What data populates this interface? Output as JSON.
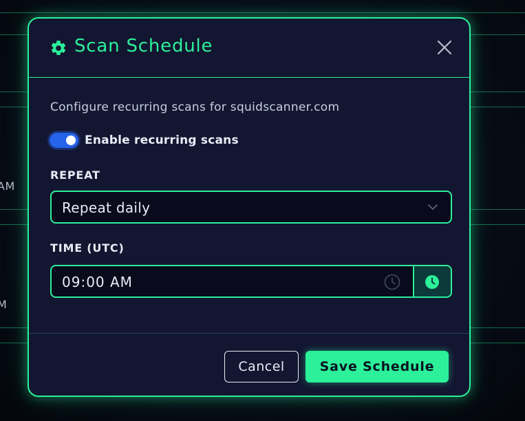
{
  "background": {
    "row_times": [
      "AM",
      "M"
    ]
  },
  "modal": {
    "title": "Scan Schedule",
    "title_icon": "gear-icon",
    "close_icon": "close-icon",
    "description": "Configure recurring scans for squidscanner.com",
    "toggle": {
      "label": "Enable recurring scans",
      "enabled": true
    },
    "repeat": {
      "label": "REPEAT",
      "selected": "Repeat daily"
    },
    "time": {
      "label": "TIME (UTC)",
      "value": "09:00 AM",
      "input_icon": "clock-icon",
      "button_icon": "clock-icon"
    },
    "buttons": {
      "cancel": "Cancel",
      "save": "Save Schedule"
    }
  },
  "colors": {
    "accent": "#2cf09a",
    "modal_bg": "#131631",
    "toggle": "#2563eb",
    "input_bg": "#090b1c"
  }
}
